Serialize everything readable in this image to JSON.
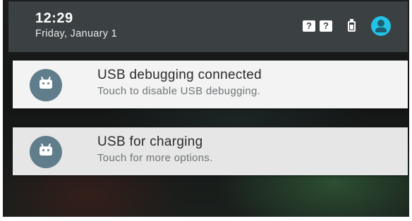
{
  "status_bar": {
    "time": "12:29",
    "date": "Friday, January 1",
    "sim1_glyph": "?",
    "sim2_glyph": "?",
    "icons": [
      "sim-unknown-icon",
      "sim-unknown-icon",
      "battery-icon",
      "user-avatar-icon"
    ],
    "header_color": "#3b4043",
    "avatar_color": "#22c3e6"
  },
  "notifications": [
    {
      "icon": "android-debug-icon",
      "title": "USB debugging connected",
      "text": "Touch to disable USB debugging."
    },
    {
      "icon": "android-usb-icon",
      "title": "USB for charging",
      "text": "Touch for more options."
    }
  ],
  "colors": {
    "icon_circle": "#607d8b",
    "card_title": "#2b2b2b",
    "card_text": "#6e7375"
  }
}
